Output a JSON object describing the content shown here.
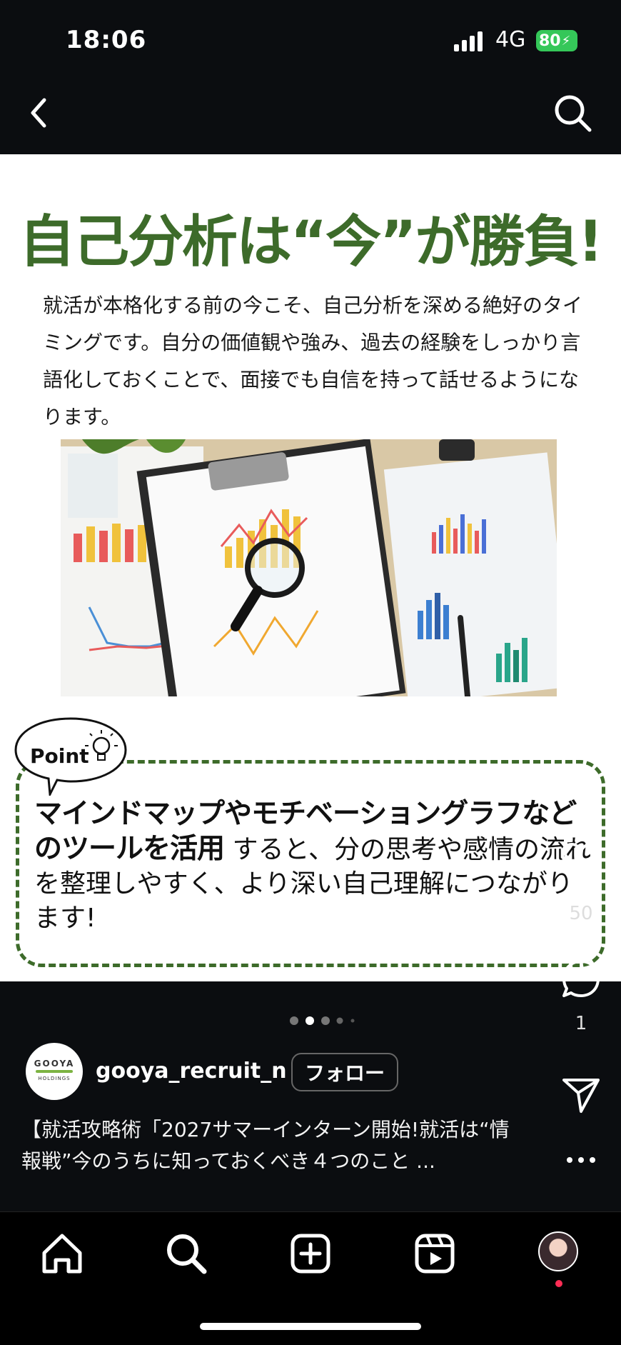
{
  "status": {
    "time": "18:06",
    "network": "4G",
    "battery": "80"
  },
  "slide": {
    "headline": "自己分析は“今”が勝負!",
    "intro": "就活が本格化する前の今こそ、自己分析を深める絶好のタイミングです。自分の価値観や強み、過去の経験をしっかり言語化しておくことで、面接でも自信を持って話せるようになります。",
    "point_label": "Point",
    "point_strong": "マインドマップやモチベーショングラフなどのツールを活用",
    "point_rest": "すると、分の思考や感情の流れを整理しやすく、より深い自己理解につながります!"
  },
  "actions": {
    "like_count": "50",
    "comment_count": "1"
  },
  "carousel": {
    "total": 5,
    "active": 1
  },
  "post": {
    "username": "gooya_recruit_n",
    "follow_label": "フォロー",
    "avatar_line1": "GOOYA",
    "avatar_line2": "HOLDINGS",
    "caption": "【就活攻略術「2027サマーインターン開始!就活は“情報戦”今のうちに知っておくべき４つのこと ..."
  },
  "colors": {
    "headline": "#3d6b2a",
    "battery": "#35c759",
    "notification": "#ff2d55"
  }
}
